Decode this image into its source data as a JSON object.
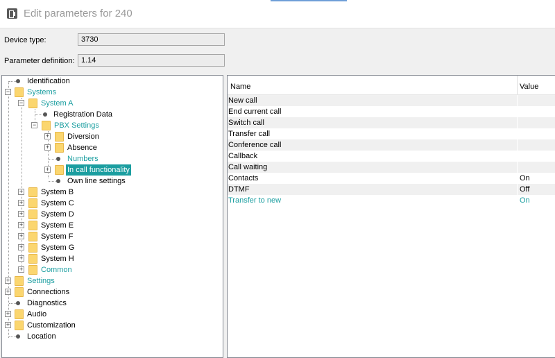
{
  "window": {
    "title": "Edit parameters for 240"
  },
  "device": {
    "type_label": "Device type:",
    "type_value": "3730",
    "definition_label": "Parameter definition:",
    "definition_value": "1.14"
  },
  "tree": {
    "identification": "Identification",
    "systems": "Systems",
    "system_a": "System A",
    "registration_data": "Registration Data",
    "pbx_settings": "PBX Settings",
    "diversion": "Diversion",
    "absence": "Absence",
    "numbers": "Numbers",
    "in_call_functionality": "In call functionality",
    "own_line_settings": "Own line settings",
    "system_b": "System B",
    "system_c": "System C",
    "system_d": "System D",
    "system_e": "System E",
    "system_f": "System F",
    "system_g": "System G",
    "system_h": "System H",
    "common": "Common",
    "settings": "Settings",
    "connections": "Connections",
    "diagnostics": "Diagnostics",
    "audio": "Audio",
    "customization": "Customization",
    "location": "Location"
  },
  "grid": {
    "columns": {
      "name": "Name",
      "value": "Value"
    },
    "rows": [
      {
        "name": "New call",
        "value": ""
      },
      {
        "name": "End current call",
        "value": ""
      },
      {
        "name": "Switch call",
        "value": ""
      },
      {
        "name": "Transfer call",
        "value": ""
      },
      {
        "name": "Conference call",
        "value": ""
      },
      {
        "name": "Callback",
        "value": ""
      },
      {
        "name": "Call waiting",
        "value": ""
      },
      {
        "name": "Contacts",
        "value": "On"
      },
      {
        "name": "DTMF",
        "value": "Off"
      },
      {
        "name": "Transfer to new",
        "value": "On"
      }
    ]
  },
  "colors": {
    "accent": "#1b9ea0",
    "folder": "#fbd66f"
  }
}
